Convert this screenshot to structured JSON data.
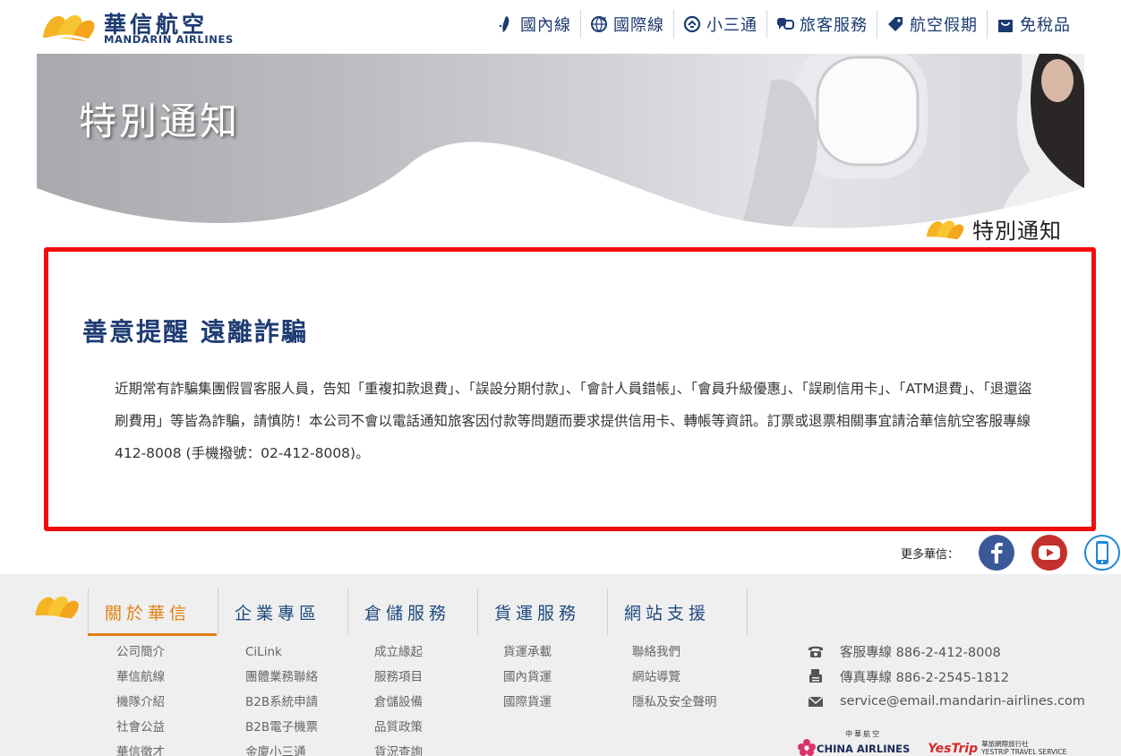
{
  "brand": {
    "name_cn": "華信航空",
    "name_en": "MANDARIN AIRLINES",
    "color_primary": "#1b3a70",
    "color_accent": "#e2810f",
    "color_logo": "#f4b323"
  },
  "topnav": {
    "items": [
      {
        "label": "國內線",
        "icon": "taiwan-map-icon"
      },
      {
        "label": "國際線",
        "icon": "globe-plane-icon"
      },
      {
        "label": "小三通",
        "icon": "ferry-exchange-icon"
      },
      {
        "label": "旅客服務",
        "icon": "customer-service-icon"
      },
      {
        "label": "航空假期",
        "icon": "luggage-tag-icon"
      },
      {
        "label": "免稅品",
        "icon": "shopping-bag-icon"
      }
    ]
  },
  "banner": {
    "title": "特別通知"
  },
  "section_label": "特別通知",
  "notice": {
    "title": "善意提醒 遠離詐騙",
    "body": "近期常有詐騙集團假冒客服人員，告知「重複扣款退費」、「誤設分期付款」、「會計人員錯帳」、「會員升級優惠」、「誤刷信用卡」、「ATM退費」、「退還盜刷費用」等皆為詐騙，請慎防！本公司不會以電話通知旅客因付款等問題而要求提供信用卡、轉帳等資訊。訂票或退票相關事宜請洽華信航空客服專線412-8008 (手機撥號：02-412-8008)。",
    "border_color": "#f10d0d"
  },
  "social": {
    "label": "更多華信：",
    "buttons": [
      {
        "name": "facebook",
        "icon": "facebook-icon",
        "color": "#3b5998"
      },
      {
        "name": "youtube",
        "icon": "youtube-icon",
        "color": "#c4302b"
      },
      {
        "name": "mobile",
        "icon": "mobile-app-icon",
        "color": "#1e88d6"
      }
    ]
  },
  "footer": {
    "tabs": [
      {
        "label": "關於華信",
        "active": true
      },
      {
        "label": "企業專區",
        "active": false
      },
      {
        "label": "倉儲服務",
        "active": false
      },
      {
        "label": "貨運服務",
        "active": false
      },
      {
        "label": "網站支援",
        "active": false
      }
    ],
    "columns": [
      [
        "公司簡介",
        "華信航線",
        "機隊介紹",
        "社會公益",
        "華信徵才"
      ],
      [
        "CiLink",
        "團體業務聯絡",
        "B2B系統申請",
        "B2B電子機票",
        "金廈小三通"
      ],
      [
        "成立緣起",
        "服務項目",
        "倉儲設備",
        "品質政策",
        "貨況查詢"
      ],
      [
        "貨運承載",
        "國內貨運",
        "國際貨運"
      ],
      [
        "聯絡我們",
        "網站導覽",
        "隱私及安全聲明"
      ]
    ],
    "contact": [
      {
        "icon": "telephone-icon",
        "text": "客服專線 886-2-412-8008"
      },
      {
        "icon": "fax-icon",
        "text": "傳真專線 886-2-2545-1812"
      },
      {
        "icon": "envelope-icon",
        "text": "service@email.mandarin-airlines.com"
      }
    ],
    "partners": {
      "china_airlines_cn": "中華航空",
      "china_airlines_en": "CHINA AIRLINES",
      "yestrip": "YesTrip",
      "yestrip_sub_cn": "華旅網際旅行社",
      "yestrip_sub_en": "YESTRIP TRAVEL SERVICE"
    }
  }
}
